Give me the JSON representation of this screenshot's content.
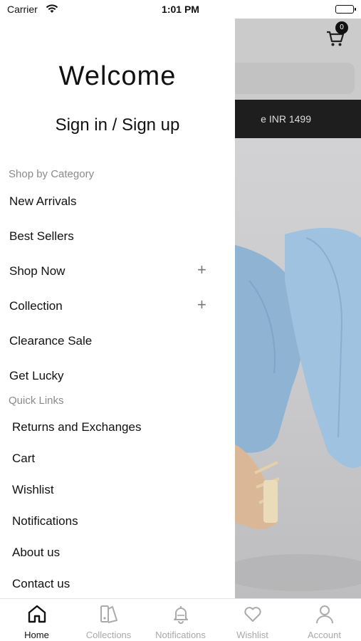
{
  "status_bar": {
    "carrier": "Carrier",
    "time": "1:01 PM"
  },
  "background_page": {
    "cart_count": "0",
    "promo_text": "e INR 1499"
  },
  "drawer": {
    "title": "Welcome",
    "sign_in_label": "Sign in / Sign up",
    "category_heading": "Shop by Category",
    "categories": [
      {
        "label": "New Arrivals",
        "expandable": false
      },
      {
        "label": "Best Sellers",
        "expandable": false
      },
      {
        "label": "Shop Now",
        "expandable": true
      },
      {
        "label": "Collection",
        "expandable": true
      },
      {
        "label": "Clearance Sale",
        "expandable": false
      },
      {
        "label": "Get Lucky",
        "expandable": false
      }
    ],
    "expand_symbol": "+",
    "quick_links_heading": "Quick Links",
    "quick_links": [
      "Returns and Exchanges",
      "Cart",
      "Wishlist",
      "Notifications",
      "About us",
      "Contact us"
    ]
  },
  "tab_bar": {
    "active": "Home",
    "tabs": [
      {
        "label": "Home",
        "icon": "home-icon"
      },
      {
        "label": "Collections",
        "icon": "collections-icon"
      },
      {
        "label": "Notifications",
        "icon": "bell-icon"
      },
      {
        "label": "Wishlist",
        "icon": "heart-icon"
      },
      {
        "label": "Account",
        "icon": "person-icon"
      }
    ]
  },
  "colors": {
    "active_tab": "#111111",
    "inactive_tab": "#a9a9a9",
    "section_heading": "#8a8a8a"
  }
}
